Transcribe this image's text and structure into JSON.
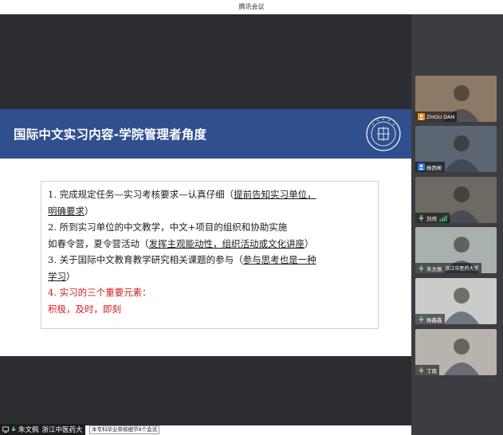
{
  "app": {
    "title": "腾讯会议"
  },
  "slide": {
    "title": "国际中文实习内容-学院管理者角度",
    "lines": [
      {
        "pre": "1.  完成规定任务—实习考核要求—认真仔细（",
        "link": "提前告知实习单位，",
        "post": ""
      },
      {
        "pre": "",
        "link": "明确要求",
        "post": "）"
      },
      {
        "pre": "2.  所到实习单位的中文教学，中文+项目的组织和协助实施",
        "link": "",
        "post": ""
      },
      {
        "pre": "     如春令营，夏令营活动（",
        "link": "发挥主观能动性，组织活动或文化讲座",
        "post": "）"
      },
      {
        "pre": "3.  关于国际中文教育教学研究相关课题的参与（",
        "link": "参与思考也是一种",
        "post": ""
      },
      {
        "pre": "",
        "link": "学习",
        "post": "）"
      }
    ],
    "red_lines": [
      "4.  实习的三个重要元素：",
      "     积极，及时，即刻"
    ]
  },
  "speaker": {
    "name": "朱文佩",
    "org": "浙江中医药大"
  },
  "notification": "本专科毕业审核细节9个会话",
  "participants": [
    {
      "name": "ZHOU DAN",
      "org": "",
      "status": "host-icon",
      "bg": "#8c7a66"
    },
    {
      "name": "杨西彬",
      "org": "",
      "status": "user-icon",
      "bg": "#5b6672"
    },
    {
      "name": "刘然",
      "org": "",
      "status": "mic-icon",
      "bg": "#6d6a63"
    },
    {
      "name": "朱文佩",
      "org": "浙江中医药大学",
      "status": "mic-icon",
      "bg": "#a9b1ae"
    },
    {
      "name": "杨鑫鑫",
      "org": "",
      "status": "mic-icon",
      "bg": "#c9ccc9"
    },
    {
      "name": "丁南",
      "org": "",
      "status": "mic-icon",
      "bg": "#b8b3ac"
    }
  ]
}
